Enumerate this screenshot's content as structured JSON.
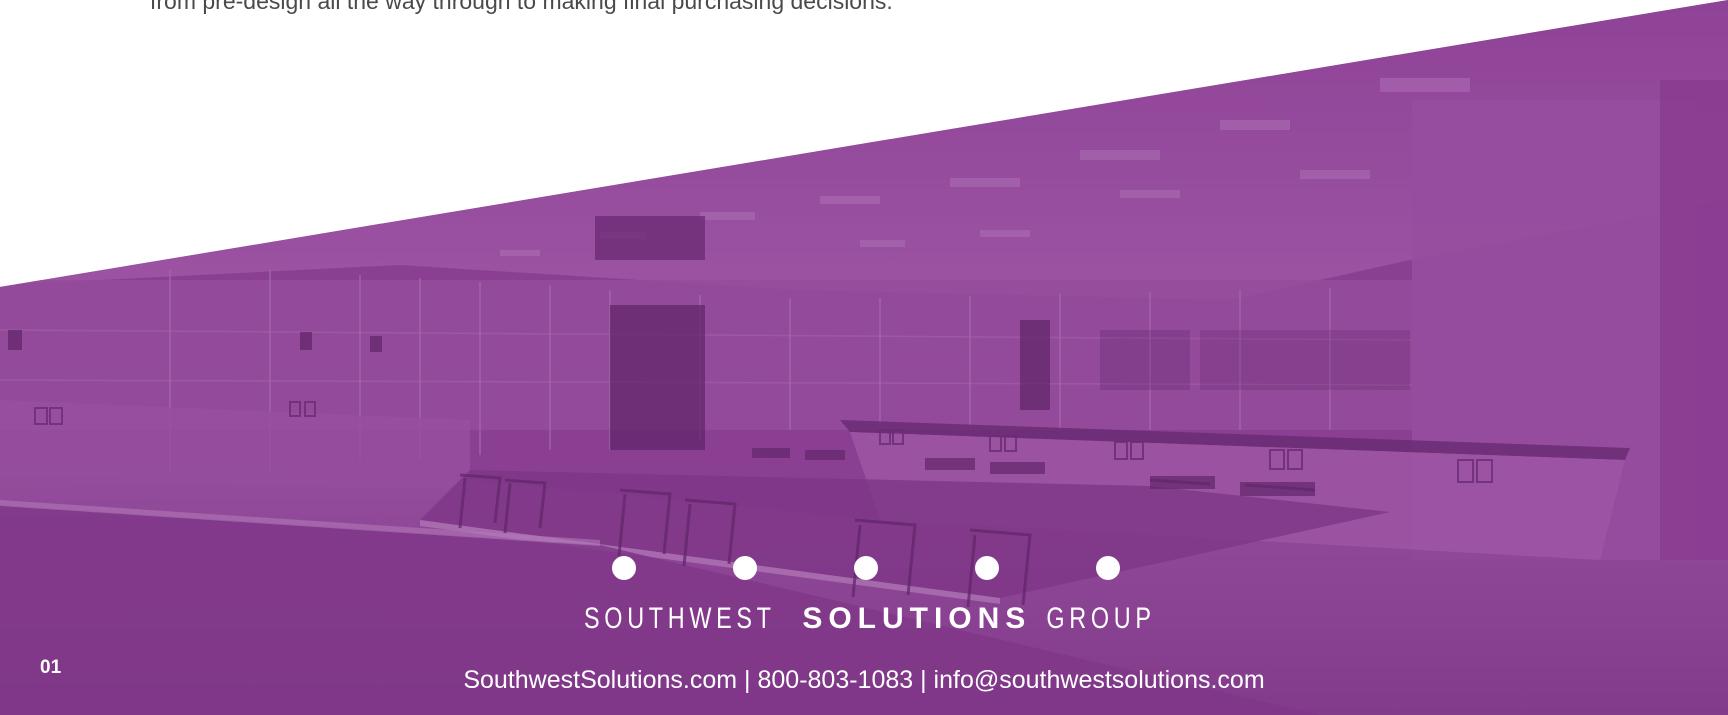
{
  "intro": {
    "text": "from pre-design all the way through to making final purchasing decisions."
  },
  "brand": {
    "name_part_1": "SOUTHWEST",
    "name_part_2": "SOLUTIONS",
    "name_part_3": "GROUP",
    "contact_line": "SouthwestSolutions.com | 800-803-1083 | info@southwestsolutions.com"
  },
  "footer": {
    "page_number": "01"
  },
  "colors": {
    "overlay_purple": "#8a3e92",
    "text_gray": "#4a4a4a",
    "white": "#ffffff"
  },
  "images": {
    "background_photo": "purple-tinted-laboratory-room-photo"
  }
}
